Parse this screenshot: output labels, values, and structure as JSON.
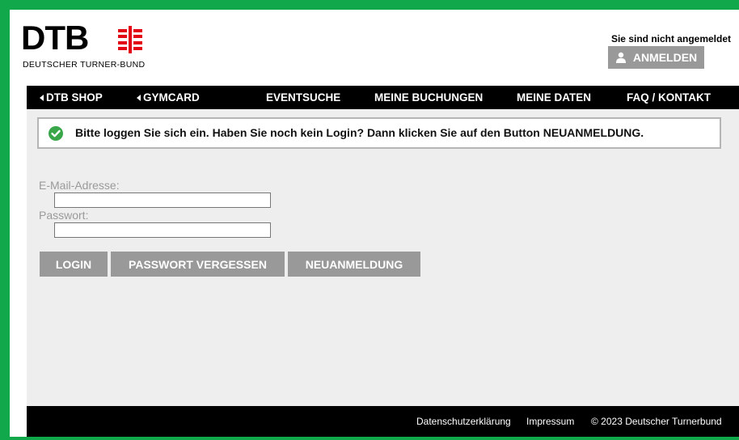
{
  "header": {
    "logo_text": "DTB",
    "logo_subtitle": "DEUTSCHER TURNER-BUND",
    "login_status": "Sie sind nicht angemeldet",
    "login_button_label": "ANMELDEN"
  },
  "nav": {
    "items": [
      {
        "label": "DTB SHOP"
      },
      {
        "label": "GYMCARD"
      },
      {
        "label": "EVENTSUCHE"
      },
      {
        "label": "MEINE BUCHUNGEN"
      },
      {
        "label": "MEINE DATEN"
      },
      {
        "label": "FAQ / KONTAKT"
      }
    ]
  },
  "alert": {
    "message": "Bitte loggen Sie sich ein. Haben Sie noch kein Login? Dann klicken Sie auf den Button NEUANMELDUNG."
  },
  "form": {
    "email_label": "E-Mail-Adresse:",
    "email_value": "",
    "password_label": "Passwort:",
    "password_value": ""
  },
  "buttons": {
    "login": "LOGIN",
    "forgot_password": "PASSWORT VERGESSEN",
    "register": "NEUANMELDUNG"
  },
  "footer": {
    "privacy": "Datenschutzerklärung",
    "imprint": "Impressum",
    "copyright": "© 2023 Deutscher Turnerbund"
  },
  "colors": {
    "frame_green": "#10a84a",
    "button_gray": "#999999",
    "nav_black": "#000000",
    "content_bg": "#eeeeee",
    "logo_red": "#e30613",
    "check_green": "#3aa64a"
  },
  "icons": {
    "logo_mark": "dtb-turner-cross-icon",
    "login": "user-icon",
    "alert": "check-circle-icon",
    "nav_arrow": "caret-left-icon"
  }
}
